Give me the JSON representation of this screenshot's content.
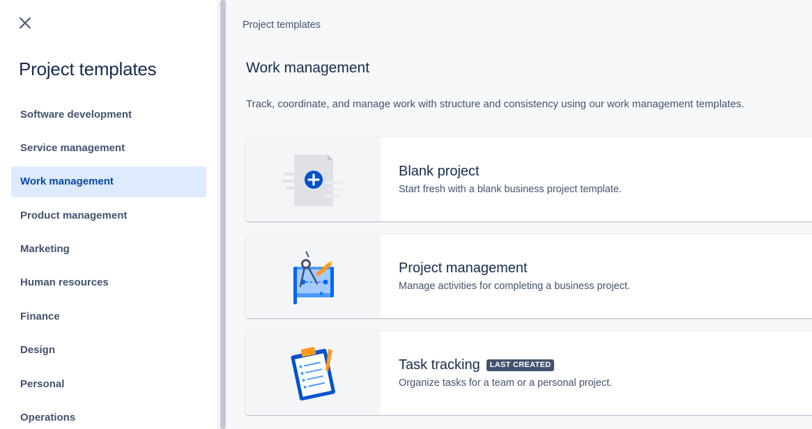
{
  "sidebar": {
    "title": "Project templates",
    "items": [
      {
        "label": "Software development",
        "active": false
      },
      {
        "label": "Service management",
        "active": false
      },
      {
        "label": "Work management",
        "active": true
      },
      {
        "label": "Product management",
        "active": false
      },
      {
        "label": "Marketing",
        "active": false
      },
      {
        "label": "Human resources",
        "active": false
      },
      {
        "label": "Finance",
        "active": false
      },
      {
        "label": "Design",
        "active": false
      },
      {
        "label": "Personal",
        "active": false
      },
      {
        "label": "Operations",
        "active": false
      }
    ]
  },
  "main": {
    "breadcrumb": "Project templates",
    "section_title": "Work management",
    "section_description": "Track, coordinate, and manage work with structure and consistency using our work management templates.",
    "cards": [
      {
        "title": "Blank project",
        "description": "Start fresh with a blank business project template.",
        "icon": "blank-project-icon"
      },
      {
        "title": "Project management",
        "description": "Manage activities for completing a business project.",
        "icon": "project-management-icon"
      },
      {
        "title": "Task tracking",
        "badge": "LAST CREATED",
        "description": "Organize tasks for a team or a personal project.",
        "icon": "task-tracking-icon"
      }
    ]
  },
  "colors": {
    "active_bg": "#deebff",
    "active_text": "#0747a6",
    "primary_blue": "#0052cc",
    "badge_bg": "#42526e"
  }
}
